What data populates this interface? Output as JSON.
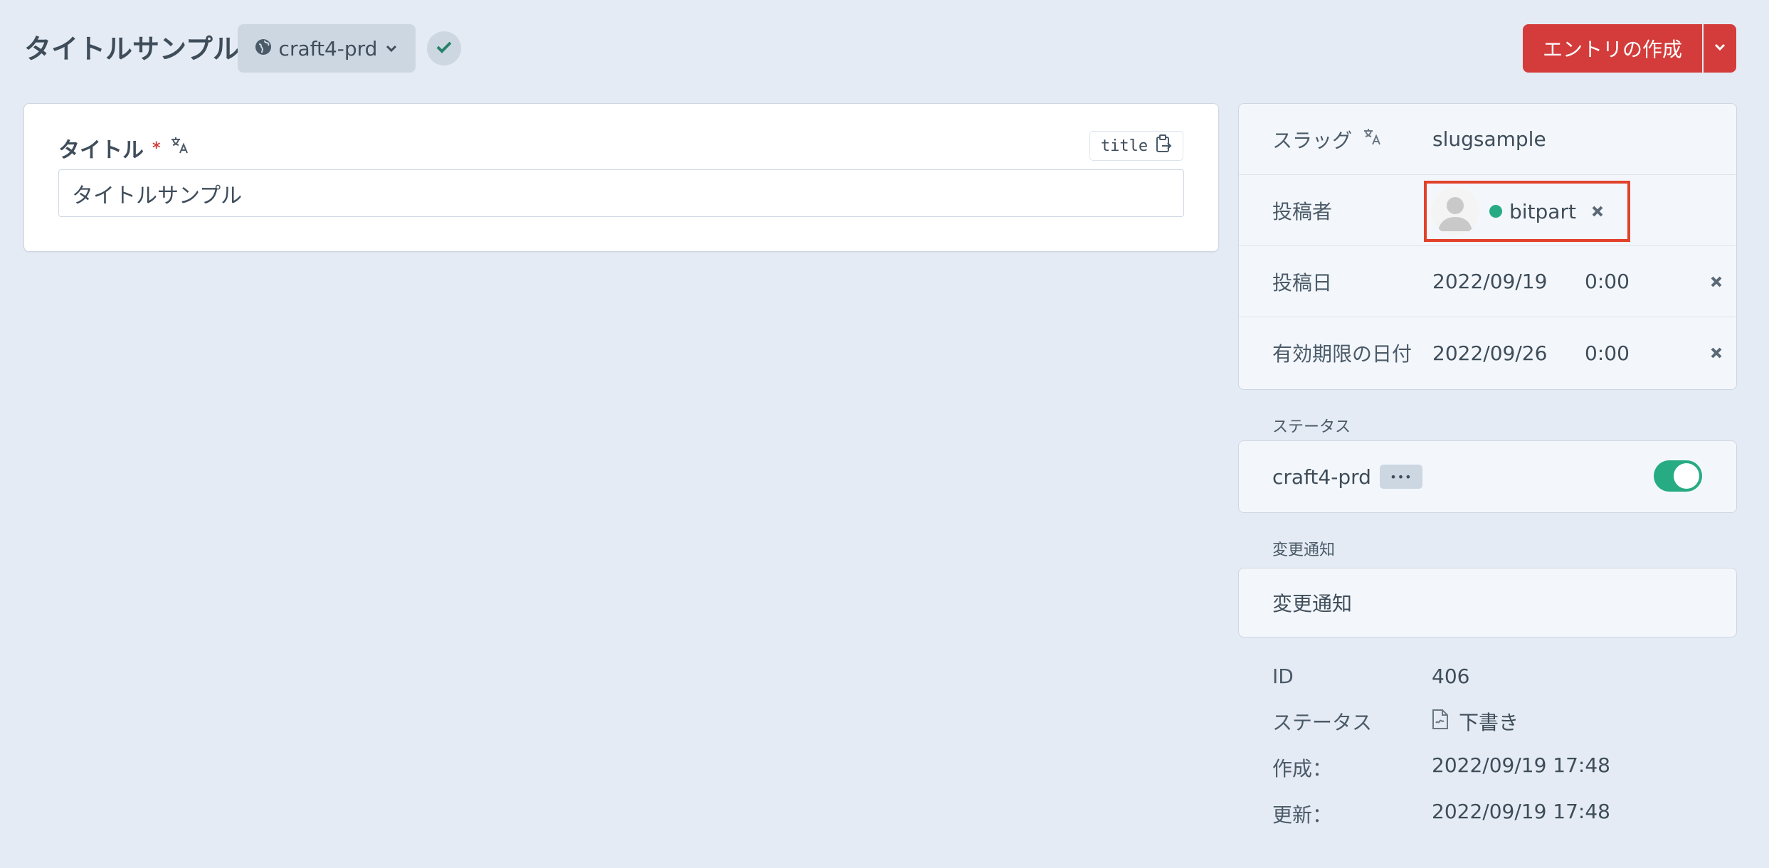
{
  "header": {
    "title": "タイトルサンプル",
    "site_selector": "craft4-prd",
    "create_button": "エントリの作成"
  },
  "main": {
    "field_label": "タイトル",
    "required_mark": "*",
    "field_handle": "title",
    "title_value": "タイトルサンプル"
  },
  "meta": {
    "slug_label": "スラッグ",
    "slug_value": "slugsample",
    "author_label": "投稿者",
    "author_name": "bitpart",
    "post_date_label": "投稿日",
    "post_date": "2022/09/19",
    "post_time": "0:00",
    "expiry_label": "有効期限の日付",
    "expiry_date": "2022/09/26",
    "expiry_time": "0:00"
  },
  "status_section": {
    "heading": "ステータス",
    "site_name": "craft4-prd",
    "more_label": "•••",
    "enabled": true
  },
  "notification_section": {
    "heading": "変更通知",
    "label": "変更通知"
  },
  "info": {
    "id_label": "ID",
    "id_value": "406",
    "status_label": "ステータス",
    "status_value": "下書き",
    "created_label": "作成：",
    "created_value": "2022/09/19 17:48",
    "updated_label": "更新：",
    "updated_value": "2022/09/19 17:48"
  },
  "colors": {
    "accent": "#d33c3b",
    "background": "#e4ebf4",
    "toggle_on": "#27ab83",
    "highlight_box": "#e2412b"
  }
}
